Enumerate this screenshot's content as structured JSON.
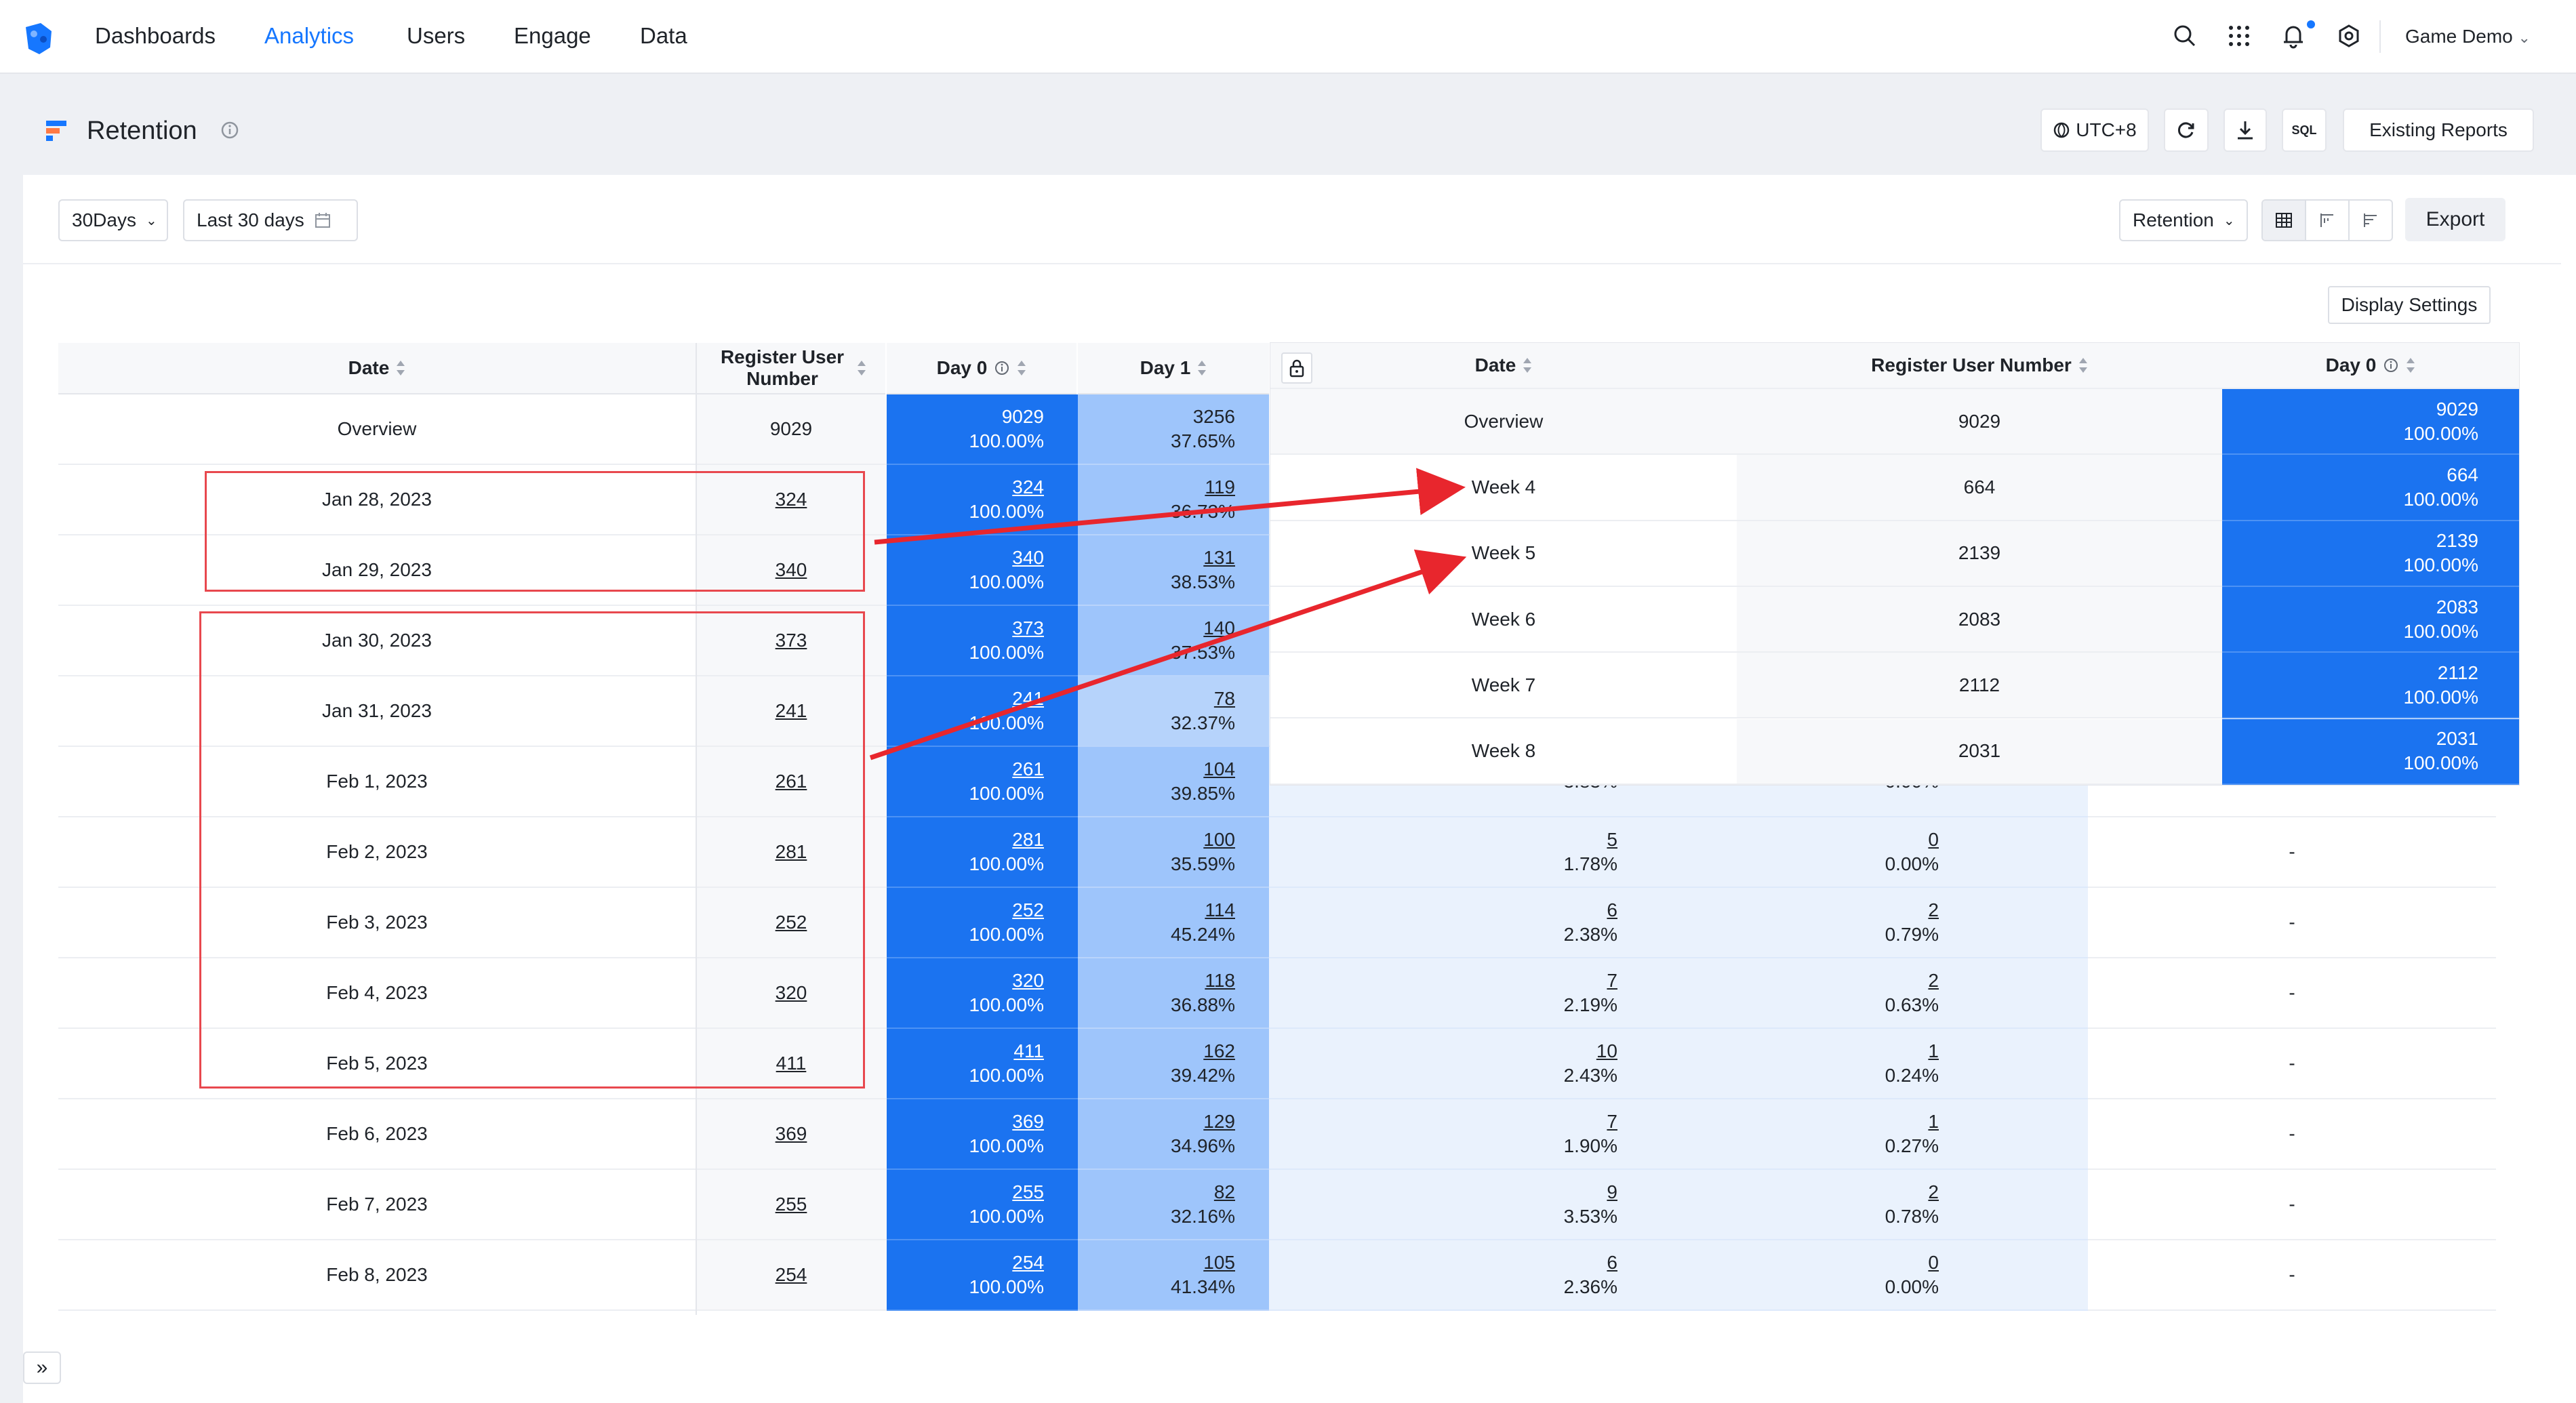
{
  "nav": {
    "items": [
      "Dashboards",
      "Analytics",
      "Users",
      "Engage",
      "Data"
    ],
    "active": "Analytics",
    "project": "Game Demo"
  },
  "header": {
    "title": "Retention",
    "timezone": "UTC+8",
    "sql_label": "SQL",
    "existing_reports": "Existing Reports"
  },
  "filters": {
    "period": "30Days",
    "range": "Last 30 days",
    "metric": "Retention",
    "export": "Export",
    "display_settings": "Display Settings"
  },
  "table": {
    "headers": [
      "Date",
      "Register User Number",
      "Day 0",
      "Day 1"
    ],
    "overview": {
      "date": "Overview",
      "users": "9029",
      "day0": [
        "9029",
        "100.00%"
      ],
      "day1": [
        "3256",
        "37.65%"
      ]
    },
    "rows": [
      {
        "date": "Jan 28, 2023",
        "users": "324",
        "day0": [
          "324",
          "100.00%"
        ],
        "day1": [
          "119",
          "36.73%"
        ],
        "day2": [
          "",
          ""
        ],
        "day3": [
          "",
          ""
        ],
        "day4": ""
      },
      {
        "date": "Jan 29, 2023",
        "users": "340",
        "day0": [
          "340",
          "100.00%"
        ],
        "day1": [
          "131",
          "38.53%"
        ],
        "day2": [
          "",
          ""
        ],
        "day3": [
          "",
          ""
        ],
        "day4": ""
      },
      {
        "date": "Jan 30, 2023",
        "users": "373",
        "day0": [
          "373",
          "100.00%"
        ],
        "day1": [
          "140",
          "37.53%"
        ],
        "day2": [
          "",
          ""
        ],
        "day3": [
          "",
          ""
        ],
        "day4": ""
      },
      {
        "date": "Jan 31, 2023",
        "users": "241",
        "day0": [
          "241",
          "100.00%"
        ],
        "day1": [
          "78",
          "32.37%"
        ],
        "day2": [
          "",
          ""
        ],
        "day3": [
          "",
          ""
        ],
        "day4": ""
      },
      {
        "date": "Feb 1, 2023",
        "users": "261",
        "day0": [
          "261",
          "100.00%"
        ],
        "day1": [
          "104",
          "39.85%"
        ],
        "day2": [
          "",
          "3.83%"
        ],
        "day3": [
          "",
          "0.00%"
        ],
        "day4": ""
      },
      {
        "date": "Feb 2, 2023",
        "users": "281",
        "day0": [
          "281",
          "100.00%"
        ],
        "day1": [
          "100",
          "35.59%"
        ],
        "day2": [
          "5",
          "1.78%"
        ],
        "day3": [
          "0",
          "0.00%"
        ],
        "day4": "-"
      },
      {
        "date": "Feb 3, 2023",
        "users": "252",
        "day0": [
          "252",
          "100.00%"
        ],
        "day1": [
          "114",
          "45.24%"
        ],
        "day2": [
          "6",
          "2.38%"
        ],
        "day3": [
          "2",
          "0.79%"
        ],
        "day4": "-"
      },
      {
        "date": "Feb 4, 2023",
        "users": "320",
        "day0": [
          "320",
          "100.00%"
        ],
        "day1": [
          "118",
          "36.88%"
        ],
        "day2": [
          "7",
          "2.19%"
        ],
        "day3": [
          "2",
          "0.63%"
        ],
        "day4": "-"
      },
      {
        "date": "Feb 5, 2023",
        "users": "411",
        "day0": [
          "411",
          "100.00%"
        ],
        "day1": [
          "162",
          "39.42%"
        ],
        "day2": [
          "10",
          "2.43%"
        ],
        "day3": [
          "1",
          "0.24%"
        ],
        "day4": "-"
      },
      {
        "date": "Feb 6, 2023",
        "users": "369",
        "day0": [
          "369",
          "100.00%"
        ],
        "day1": [
          "129",
          "34.96%"
        ],
        "day2": [
          "7",
          "1.90%"
        ],
        "day3": [
          "1",
          "0.27%"
        ],
        "day4": "-"
      },
      {
        "date": "Feb 7, 2023",
        "users": "255",
        "day0": [
          "255",
          "100.00%"
        ],
        "day1": [
          "82",
          "32.16%"
        ],
        "day2": [
          "9",
          "3.53%"
        ],
        "day3": [
          "2",
          "0.78%"
        ],
        "day4": "-"
      },
      {
        "date": "Feb 8, 2023",
        "users": "254",
        "day0": [
          "254",
          "100.00%"
        ],
        "day1": [
          "105",
          "41.34%"
        ],
        "day2": [
          "6",
          "2.36%"
        ],
        "day3": [
          "0",
          "0.00%"
        ],
        "day4": "-"
      }
    ]
  },
  "weekly": {
    "headers": [
      "Date",
      "Register User Number",
      "Day 0"
    ],
    "rows": [
      {
        "date": "Overview",
        "users": "9029",
        "day0": [
          "9029",
          "100.00%"
        ]
      },
      {
        "date": "Week 4",
        "users": "664",
        "day0": [
          "664",
          "100.00%"
        ]
      },
      {
        "date": "Week 5",
        "users": "2139",
        "day0": [
          "2139",
          "100.00%"
        ]
      },
      {
        "date": "Week 6",
        "users": "2083",
        "day0": [
          "2083",
          "100.00%"
        ]
      },
      {
        "date": "Week 7",
        "users": "2112",
        "day0": [
          "2112",
          "100.00%"
        ]
      },
      {
        "date": "Week 8",
        "users": "2031",
        "day0": [
          "2031",
          "100.00%"
        ]
      }
    ]
  },
  "colors": {
    "accent": "#1677ff",
    "day0": "#1b73f0",
    "day1": "#9ec5fb",
    "annotation": "#e8484e"
  }
}
